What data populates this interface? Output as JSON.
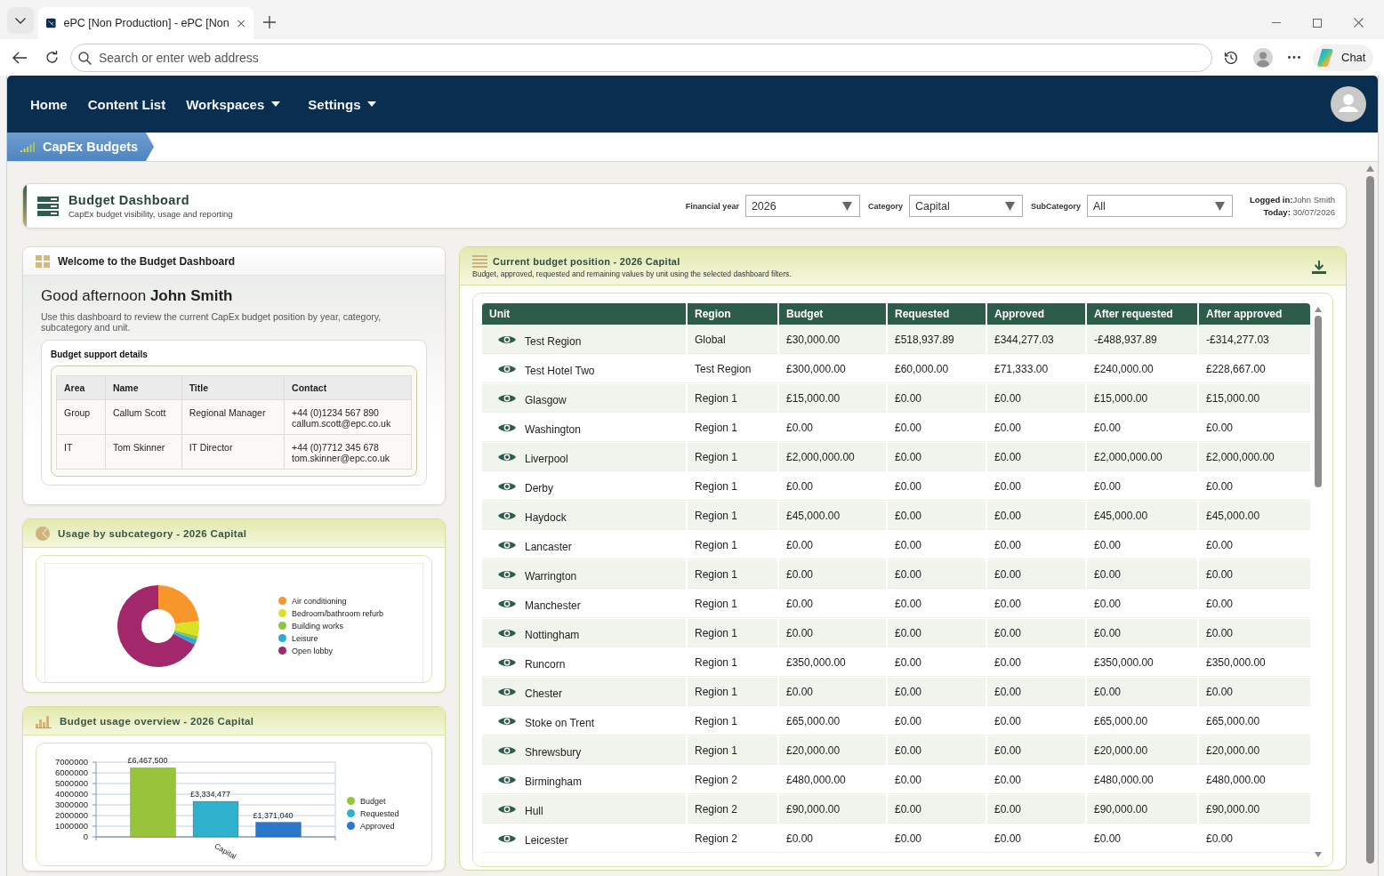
{
  "browser": {
    "tabs": [
      {
        "title": "ePC [Non Production] - ePC [Non",
        "selected": true
      }
    ],
    "address_bar": {
      "placeholder": "Search or enter web address"
    },
    "chat_button": "Chat"
  },
  "nav": {
    "items": [
      {
        "label": "Home",
        "dropdown": false
      },
      {
        "label": "Content List",
        "dropdown": false
      },
      {
        "label": "Workspaces",
        "dropdown": true
      },
      {
        "label": "Settings",
        "dropdown": true
      }
    ]
  },
  "breadcrumb": {
    "label": "CapEx Budgets"
  },
  "header": {
    "title": "Budget Dashboard",
    "subtitle": "CapEx budget visibility, usage and reporting",
    "filters": [
      {
        "label": "Financial year",
        "value": "2026"
      },
      {
        "label": "Category",
        "value": "Capital"
      },
      {
        "label": "SubCategory",
        "value": "All"
      }
    ],
    "logged_in": "**Logged in:**John Smith",
    "today": "**Today:** 30/07/2026"
  },
  "welcome": {
    "title": "Welcome to the Budget Dashboard",
    "greeting": "Good afternoon **John Smith**",
    "intro": "Use this dashboard to review the current CapEx budget position by year, category, subcategory and unit.",
    "support": {
      "title": "Budget support details",
      "columns": [
        "Area",
        "Name",
        "Title",
        "Contact"
      ],
      "rows": [
        {
          "area": "Group",
          "name": "Callum Scott",
          "title": "Regional Manager",
          "phone": "+44 (0)1234 567 890",
          "email": "callum.scott@epc.co.uk"
        },
        {
          "area": "IT",
          "name": "Tom Skinner",
          "title": "IT Director",
          "phone": "+44 (0)7712 345 678",
          "email": "tom.skinner@epc.co.uk"
        }
      ]
    }
  },
  "usage": {
    "title": "Usage by subcategory - 2026 Capital",
    "chart_data": {
      "type": "donut",
      "categories": [
        "Air conditioning",
        "Bedroom/bathroom refurb",
        "Building works",
        "Leisure",
        "Open lobby"
      ],
      "values": [
        23,
        6,
        1.5,
        2,
        67.5
      ],
      "colors": [
        "#f7962b",
        "#dce024",
        "#8cc540",
        "#2aa9df",
        "#a3276b"
      ],
      "legend": "right"
    }
  },
  "overview": {
    "title": "Budget usage overview - 2026 Capital",
    "chart_data": {
      "type": "bar",
      "categories": [
        "Capital"
      ],
      "series": [
        {
          "name": "Budget",
          "color": "#97c43a",
          "values": [
            6467500
          ]
        },
        {
          "name": "Requested",
          "color": "#2db1cc",
          "values": [
            3334477
          ]
        },
        {
          "name": "Approved",
          "color": "#2a78c9",
          "values": [
            1371040
          ]
        }
      ],
      "ylim": [
        0,
        7000000
      ],
      "yticks": [
        0,
        1000000,
        2000000,
        3000000,
        4000000,
        5000000,
        6000000,
        7000000
      ],
      "value_labels": [
        "£6,467,500",
        "£3,334,477",
        "£1,371,040"
      ],
      "grid": true,
      "legend": "right"
    }
  },
  "position": {
    "title": "Current budget position - 2026 Capital",
    "subtitle": "Budget, approved, requested and remaining values by unit using the selected dashboard filters.",
    "table": {
      "columns": [
        "Unit",
        "Region",
        "Budget",
        "Requested",
        "Approved",
        "After requested",
        "After approved"
      ],
      "rows": [
        {
          "unit": "Test Region",
          "region": "Global",
          "budget": "£30,000.00",
          "requested": "£518,937.89",
          "approved": "£344,277.03",
          "after_requested": "-£488,937.89",
          "after_approved": "-£314,277.03"
        },
        {
          "unit": "Test Hotel Two",
          "region": "Test Region",
          "budget": "£300,000.00",
          "requested": "£60,000.00",
          "approved": "£71,333.00",
          "after_requested": "£240,000.00",
          "after_approved": "£228,667.00"
        },
        {
          "unit": "Glasgow",
          "region": "Region 1",
          "budget": "£15,000.00",
          "requested": "£0.00",
          "approved": "£0.00",
          "after_requested": "£15,000.00",
          "after_approved": "£15,000.00"
        },
        {
          "unit": "Washington",
          "region": "Region 1",
          "budget": "£0.00",
          "requested": "£0.00",
          "approved": "£0.00",
          "after_requested": "£0.00",
          "after_approved": "£0.00"
        },
        {
          "unit": "Liverpool",
          "region": "Region 1",
          "budget": "£2,000,000.00",
          "requested": "£0.00",
          "approved": "£0.00",
          "after_requested": "£2,000,000.00",
          "after_approved": "£2,000,000.00"
        },
        {
          "unit": "Derby",
          "region": "Region 1",
          "budget": "£0.00",
          "requested": "£0.00",
          "approved": "£0.00",
          "after_requested": "£0.00",
          "after_approved": "£0.00"
        },
        {
          "unit": "Haydock",
          "region": "Region 1",
          "budget": "£45,000.00",
          "requested": "£0.00",
          "approved": "£0.00",
          "after_requested": "£45,000.00",
          "after_approved": "£45,000.00"
        },
        {
          "unit": "Lancaster",
          "region": "Region 1",
          "budget": "£0.00",
          "requested": "£0.00",
          "approved": "£0.00",
          "after_requested": "£0.00",
          "after_approved": "£0.00"
        },
        {
          "unit": "Warrington",
          "region": "Region 1",
          "budget": "£0.00",
          "requested": "£0.00",
          "approved": "£0.00",
          "after_requested": "£0.00",
          "after_approved": "£0.00"
        },
        {
          "unit": "Manchester",
          "region": "Region 1",
          "budget": "£0.00",
          "requested": "£0.00",
          "approved": "£0.00",
          "after_requested": "£0.00",
          "after_approved": "£0.00"
        },
        {
          "unit": "Nottingham",
          "region": "Region 1",
          "budget": "£0.00",
          "requested": "£0.00",
          "approved": "£0.00",
          "after_requested": "£0.00",
          "after_approved": "£0.00"
        },
        {
          "unit": "Runcorn",
          "region": "Region 1",
          "budget": "£350,000.00",
          "requested": "£0.00",
          "approved": "£0.00",
          "after_requested": "£350,000.00",
          "after_approved": "£350,000.00"
        },
        {
          "unit": "Chester",
          "region": "Region 1",
          "budget": "£0.00",
          "requested": "£0.00",
          "approved": "£0.00",
          "after_requested": "£0.00",
          "after_approved": "£0.00"
        },
        {
          "unit": "Stoke on Trent",
          "region": "Region 1",
          "budget": "£65,000.00",
          "requested": "£0.00",
          "approved": "£0.00",
          "after_requested": "£65,000.00",
          "after_approved": "£65,000.00"
        },
        {
          "unit": "Shrewsbury",
          "region": "Region 1",
          "budget": "£20,000.00",
          "requested": "£0.00",
          "approved": "£0.00",
          "after_requested": "£20,000.00",
          "after_approved": "£20,000.00"
        },
        {
          "unit": "Birmingham",
          "region": "Region 2",
          "budget": "£480,000.00",
          "requested": "£0.00",
          "approved": "£0.00",
          "after_requested": "£480,000.00",
          "after_approved": "£480,000.00"
        },
        {
          "unit": "Hull",
          "region": "Region 2",
          "budget": "£90,000.00",
          "requested": "£0.00",
          "approved": "£0.00",
          "after_requested": "£90,000.00",
          "after_approved": "£90,000.00"
        },
        {
          "unit": "Leicester",
          "region": "Region 2",
          "budget": "£0.00",
          "requested": "£0.00",
          "approved": "£0.00",
          "after_requested": "£0.00",
          "after_approved": "£0.00"
        }
      ]
    }
  }
}
